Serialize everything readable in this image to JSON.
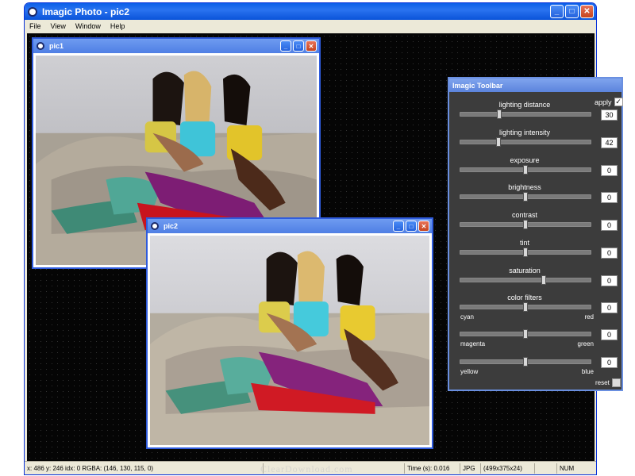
{
  "app": {
    "title": "Imagic Photo - pic2"
  },
  "menu": [
    "File",
    "View",
    "Window",
    "Help"
  ],
  "windows": {
    "pic1": {
      "title": "pic1"
    },
    "pic2": {
      "title": "pic2"
    }
  },
  "toolbar": {
    "title": "Imagic Toolbar",
    "apply_label": "apply",
    "apply_checked": true,
    "reset_label": "reset",
    "sliders": [
      {
        "label": "lighting distance",
        "value": "30",
        "pos": 0.3
      },
      {
        "label": "lighting intensity",
        "value": "42",
        "pos": 0.29
      },
      {
        "label": "exposure",
        "value": "0",
        "pos": 0.5
      },
      {
        "label": "brightness",
        "value": "0",
        "pos": 0.5
      },
      {
        "label": "contrast",
        "value": "0",
        "pos": 0.5
      },
      {
        "label": "tint",
        "value": "0",
        "pos": 0.5
      },
      {
        "label": "saturation",
        "value": "0",
        "pos": 0.64
      },
      {
        "label": "color filters",
        "value": "0",
        "pos": 0.5,
        "left": "cyan",
        "right": "red"
      },
      {
        "label": "",
        "value": "0",
        "pos": 0.5,
        "left": "magenta",
        "right": "green"
      },
      {
        "label": "",
        "value": "0",
        "pos": 0.5,
        "left": "yellow",
        "right": "blue"
      }
    ]
  },
  "status": {
    "coords": "x: 486 y: 246  idx: 0  RGBA: (146, 130, 115, 0)",
    "time": "Time (s): 0.016",
    "format": "JPG",
    "dims": "(499x375x24)",
    "num": "NUM"
  },
  "watermark": "ClearDownload.com",
  "icons": {
    "minimize": "_",
    "maximize": "□",
    "close": "✕",
    "check": "✓"
  }
}
